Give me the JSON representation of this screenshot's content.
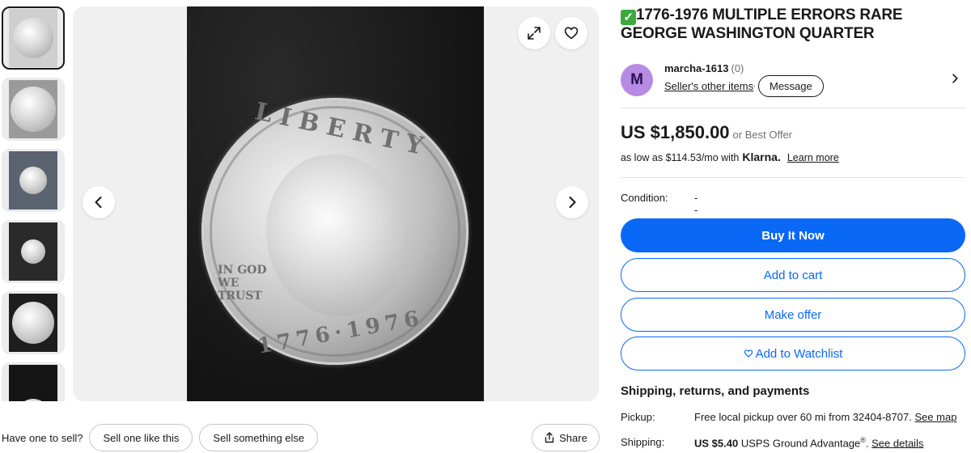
{
  "gallery": {
    "thumbnail_count": 6,
    "prev_label": "previous-image",
    "next_label": "next-image",
    "coin_inscriptions": {
      "liberty": "LIBERTY",
      "trust": "IN GOD WE TRUST",
      "date": "1776·1976"
    }
  },
  "sell": {
    "label": "Have one to sell?",
    "sell_one": "Sell one like this",
    "sell_else": "Sell something else"
  },
  "share_label": "Share",
  "listing": {
    "title": "1776-1976 MULTIPLE ERRORS RARE GEORGE WASHINGTON QUARTER",
    "seller": {
      "initial": "M",
      "name": "marcha-1613",
      "score": "(0)",
      "other_items": "Seller's other items",
      "message": "Message"
    },
    "price": "US $1,850.00",
    "best_offer": "or Best Offer",
    "klarna": {
      "prefix": "as low as $114.53/mo with",
      "logo": "Klarna.",
      "learn_more": "Learn more"
    },
    "condition_label": "Condition:",
    "condition_value": "--",
    "buttons": {
      "buy": "Buy It Now",
      "cart": "Add to cart",
      "offer": "Make offer",
      "watch": "Add to Watchlist"
    }
  },
  "shipping": {
    "heading": "Shipping, returns, and payments",
    "pickup_label": "Pickup:",
    "pickup_text": "Free local pickup over 60 mi from 32404-8707.",
    "pickup_link": "See map",
    "shipping_label": "Shipping:",
    "shipping_price": "US $5.40",
    "shipping_service": "USPS Ground Advantage",
    "shipping_mark": "®",
    "shipping_link": "See details"
  },
  "colors": {
    "primary": "#0968f6",
    "avatar": "#b78be4",
    "check": "#3caa3c"
  }
}
